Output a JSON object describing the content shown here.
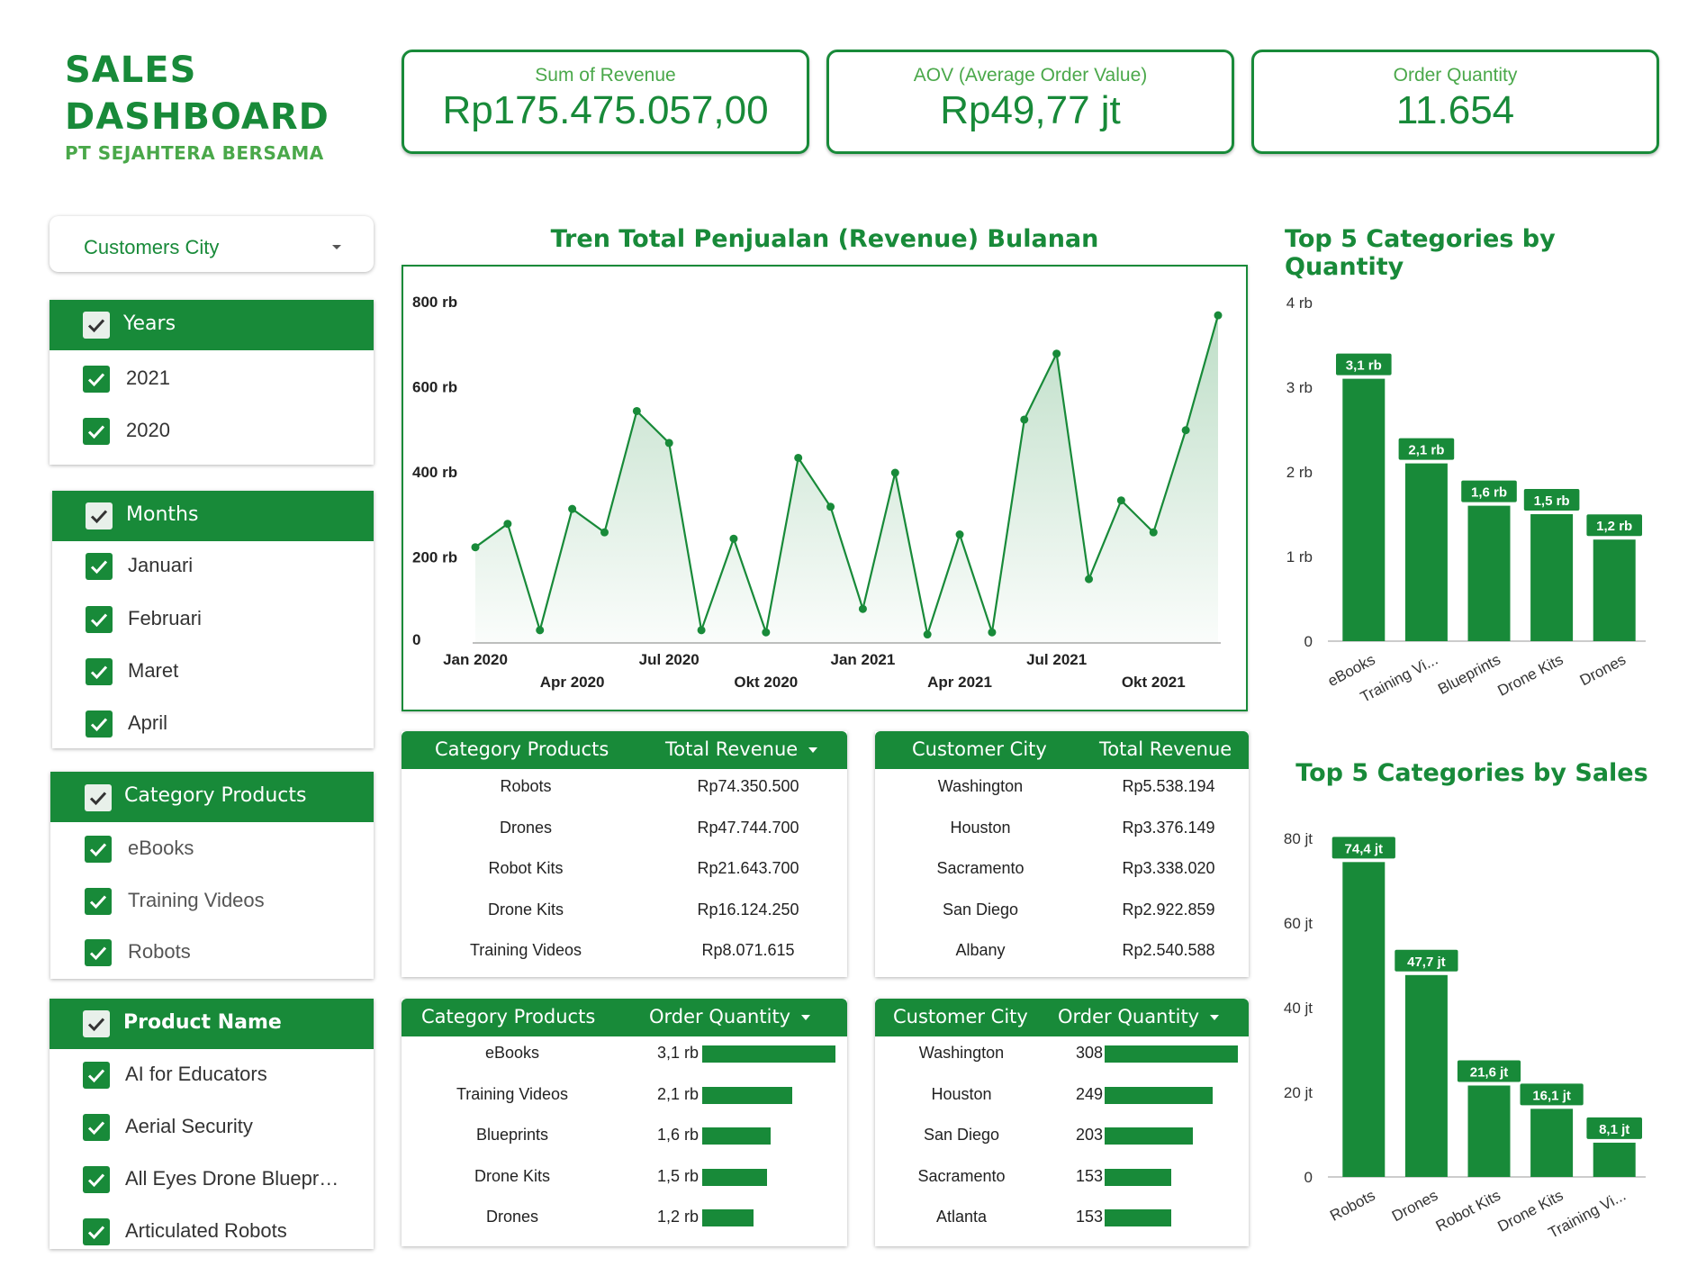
{
  "header": {
    "title_line1": "SALES",
    "title_line2": "DASHBOARD",
    "subtitle": "PT SEJAHTERA BERSAMA"
  },
  "kpis": [
    {
      "label": "Sum of Revenue",
      "value": "Rp175.475.057,00"
    },
    {
      "label": "AOV (Average Order Value)",
      "value": "Rp49,77 jt"
    },
    {
      "label": "Order Quantity",
      "value": "11.654"
    }
  ],
  "filters": {
    "city_dropdown": "Customers City",
    "years": {
      "title": "Years",
      "items": [
        "2021",
        "2020"
      ]
    },
    "months": {
      "title": "Months",
      "items": [
        "Januari",
        "Februari",
        "Maret",
        "April"
      ]
    },
    "categories": {
      "title": "Category Products",
      "items": [
        "eBooks",
        "Training Videos",
        "Robots"
      ]
    },
    "products": {
      "title": "Product Name",
      "items": [
        "AI for Educators",
        "Aerial Security",
        "All Eyes Drone Bluepr…",
        "Articulated Robots"
      ]
    }
  },
  "colors": {
    "primary": "#188a39",
    "light": "#4aa84a",
    "fill": "#e6f3e9"
  },
  "chart_data": [
    {
      "type": "area",
      "title": "Tren Total Penjualan (Revenue) Bulanan",
      "x": [
        "Jan 2020",
        "Feb 2020",
        "Mar 2020",
        "Apr 2020",
        "Mei 2020",
        "Jun 2020",
        "Jul 2020",
        "Agu 2020",
        "Sep 2020",
        "Okt 2020",
        "Nov 2020",
        "Des 2020",
        "Jan 2021",
        "Feb 2021",
        "Mar 2021",
        "Apr 2021",
        "Mei 2021",
        "Jun 2021",
        "Jul 2021",
        "Agu 2021",
        "Sep 2021",
        "Okt 2021",
        "Nov 2021",
        "Des 2021"
      ],
      "x_tick_labels": [
        {
          "label": "Jan 2020",
          "index": 0,
          "row": 0
        },
        {
          "label": "Apr 2020",
          "index": 3,
          "row": 1
        },
        {
          "label": "Jul 2020",
          "index": 6,
          "row": 0
        },
        {
          "label": "Okt 2020",
          "index": 9,
          "row": 1
        },
        {
          "label": "Jan 2021",
          "index": 12,
          "row": 0
        },
        {
          "label": "Apr 2021",
          "index": 15,
          "row": 1
        },
        {
          "label": "Jul 2021",
          "index": 18,
          "row": 0
        },
        {
          "label": "Okt 2021",
          "index": 21,
          "row": 1
        }
      ],
      "values": [
        225000,
        280000,
        30000,
        315000,
        260000,
        545000,
        470000,
        30000,
        245000,
        25000,
        435000,
        320000,
        80000,
        400000,
        20000,
        255000,
        25000,
        525000,
        680000,
        150000,
        335000,
        260000,
        500000,
        770000
      ],
      "ylim": [
        0,
        800000
      ],
      "y_ticks": [
        {
          "v": 0,
          "label": "0"
        },
        {
          "v": 200000,
          "label": "200 rb"
        },
        {
          "v": 400000,
          "label": "400 rb"
        },
        {
          "v": 600000,
          "label": "600 rb"
        },
        {
          "v": 800000,
          "label": "800 rb"
        }
      ]
    },
    {
      "type": "bar",
      "title": "Top 5 Categories by Quantity",
      "categories": [
        "eBooks",
        "Training Vi...",
        "Blueprints",
        "Drone Kits",
        "Drones"
      ],
      "values": [
        3100,
        2100,
        1600,
        1500,
        1200
      ],
      "data_labels": [
        "3,1 rb",
        "2,1 rb",
        "1,6 rb",
        "1,5 rb",
        "1,2 rb"
      ],
      "ylim": [
        0,
        4000
      ],
      "y_ticks": [
        {
          "v": 0,
          "label": "0"
        },
        {
          "v": 1000,
          "label": "1 rb"
        },
        {
          "v": 2000,
          "label": "2 rb"
        },
        {
          "v": 3000,
          "label": "3 rb"
        },
        {
          "v": 4000,
          "label": "4 rb"
        }
      ]
    },
    {
      "type": "bar",
      "title": "Top 5 Categories by Sales",
      "categories": [
        "Robots",
        "Drones",
        "Robot Kits",
        "Drone Kits",
        "Training Vi..."
      ],
      "values": [
        74.4,
        47.7,
        21.6,
        16.1,
        8.1
      ],
      "data_labels": [
        "74,4 jt",
        "47,7 jt",
        "21,6 jt",
        "16,1 jt",
        "8,1 jt"
      ],
      "ylim": [
        0,
        80
      ],
      "y_ticks": [
        {
          "v": 0,
          "label": "0"
        },
        {
          "v": 20,
          "label": "20 jt"
        },
        {
          "v": 40,
          "label": "40 jt"
        },
        {
          "v": 60,
          "label": "60 jt"
        },
        {
          "v": 80,
          "label": "80 jt"
        }
      ]
    }
  ],
  "tables": {
    "cat_revenue": {
      "headers": [
        "Category Products",
        "Total Revenue"
      ],
      "rows": [
        [
          "Robots",
          "Rp74.350.500"
        ],
        [
          "Drones",
          "Rp47.744.700"
        ],
        [
          "Robot Kits",
          "Rp21.643.700"
        ],
        [
          "Drone Kits",
          "Rp16.124.250"
        ],
        [
          "Training Videos",
          "Rp8.071.615"
        ]
      ]
    },
    "city_revenue": {
      "headers": [
        "Customer City",
        "Total Revenue"
      ],
      "rows": [
        [
          "Washington",
          "Rp5.538.194"
        ],
        [
          "Houston",
          "Rp3.376.149"
        ],
        [
          "Sacramento",
          "Rp3.338.020"
        ],
        [
          "San Diego",
          "Rp2.922.859"
        ],
        [
          "Albany",
          "Rp2.540.588"
        ]
      ]
    },
    "cat_qty": {
      "headers": [
        "Category Products",
        "Order Quantity"
      ],
      "rows": [
        [
          "eBooks",
          "3,1 rb"
        ],
        [
          "Training Videos",
          "2,1 rb"
        ],
        [
          "Blueprints",
          "1,6 rb"
        ],
        [
          "Drone Kits",
          "1,5 rb"
        ],
        [
          "Drones",
          "1,2 rb"
        ]
      ],
      "values": [
        3100,
        2100,
        1600,
        1500,
        1200
      ]
    },
    "city_qty": {
      "headers": [
        "Customer City",
        "Order Quantity"
      ],
      "rows": [
        [
          "Washington",
          "308"
        ],
        [
          "Houston",
          "249"
        ],
        [
          "San Diego",
          "203"
        ],
        [
          "Sacramento",
          "153"
        ],
        [
          "Atlanta",
          "153"
        ]
      ],
      "values": [
        308,
        249,
        203,
        153,
        153
      ]
    }
  }
}
